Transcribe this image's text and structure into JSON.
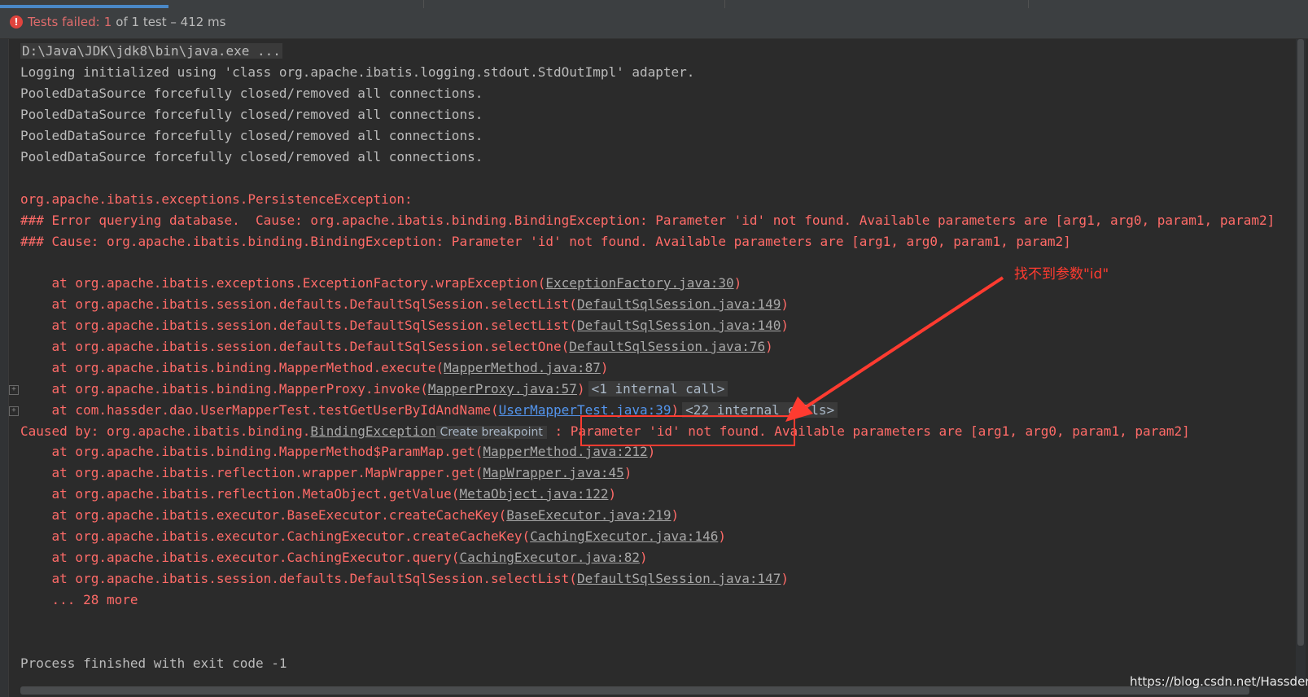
{
  "status": {
    "label": "Tests failed:",
    "count": "1",
    "detail": "of 1 test – 412 ms"
  },
  "console": {
    "command": "D:\\Java\\JDK\\jdk8\\bin\\java.exe ...",
    "log_lines": [
      "Logging initialized using 'class org.apache.ibatis.logging.stdout.StdOutImpl' adapter.",
      "PooledDataSource forcefully closed/removed all connections.",
      "PooledDataSource forcefully closed/removed all connections.",
      "PooledDataSource forcefully closed/removed all connections.",
      "PooledDataSource forcefully closed/removed all connections."
    ],
    "exception_lines": [
      "org.apache.ibatis.exceptions.PersistenceException: ",
      "### Error querying database.  Cause: org.apache.ibatis.binding.BindingException: Parameter 'id' not found. Available parameters are [arg1, arg0, param1, param2]",
      "### Cause: org.apache.ibatis.binding.BindingException: Parameter 'id' not found. Available parameters are [arg1, arg0, param1, param2]"
    ],
    "stack1": [
      {
        "pre": "    at org.apache.ibatis.exceptions.ExceptionFactory.wrapException(",
        "link": "ExceptionFactory.java:30",
        "post": ")"
      },
      {
        "pre": "    at org.apache.ibatis.session.defaults.DefaultSqlSession.selectList(",
        "link": "DefaultSqlSession.java:149",
        "post": ")"
      },
      {
        "pre": "    at org.apache.ibatis.session.defaults.DefaultSqlSession.selectList(",
        "link": "DefaultSqlSession.java:140",
        "post": ")"
      },
      {
        "pre": "    at org.apache.ibatis.session.defaults.DefaultSqlSession.selectOne(",
        "link": "DefaultSqlSession.java:76",
        "post": ")"
      },
      {
        "pre": "    at org.apache.ibatis.binding.MapperMethod.execute(",
        "link": "MapperMethod.java:87",
        "post": ")"
      },
      {
        "pre": "    at org.apache.ibatis.binding.MapperProxy.invoke(",
        "link": "MapperProxy.java:57",
        "post": ")",
        "hint": "<1 internal call>"
      },
      {
        "pre": "    at com.hassder.dao.UserMapperTest.testGetUserByIdAndName(",
        "link": "UserMapperTest.java:39",
        "post": ")",
        "hint": "<22 internal calls>"
      }
    ],
    "caused_by": {
      "pre": "Caused by: org.apache.ibatis.binding.",
      "link": "BindingException",
      "breakpoint": "Create breakpoint",
      "sep": " : ",
      "message": "Parameter 'id' not found.",
      "rest": " Available parameters are [arg1, arg0, param1, param2]"
    },
    "stack2": [
      {
        "pre": "    at org.apache.ibatis.binding.MapperMethod$ParamMap.get(",
        "link": "MapperMethod.java:212",
        "post": ")"
      },
      {
        "pre": "    at org.apache.ibatis.reflection.wrapper.MapWrapper.get(",
        "link": "MapWrapper.java:45",
        "post": ")"
      },
      {
        "pre": "    at org.apache.ibatis.reflection.MetaObject.getValue(",
        "link": "MetaObject.java:122",
        "post": ")"
      },
      {
        "pre": "    at org.apache.ibatis.executor.BaseExecutor.createCacheKey(",
        "link": "BaseExecutor.java:219",
        "post": ")"
      },
      {
        "pre": "    at org.apache.ibatis.executor.CachingExecutor.createCacheKey(",
        "link": "CachingExecutor.java:146",
        "post": ")"
      },
      {
        "pre": "    at org.apache.ibatis.executor.CachingExecutor.query(",
        "link": "CachingExecutor.java:82",
        "post": ")"
      },
      {
        "pre": "    at org.apache.ibatis.session.defaults.DefaultSqlSession.selectList(",
        "link": "DefaultSqlSession.java:147",
        "post": ")"
      }
    ],
    "more": "    ... 28 more",
    "exit": "Process finished with exit code -1"
  },
  "annotation": "找不到参数\"id\"",
  "watermark": "https://blog.csdn.net/Hassder",
  "colors": {
    "background": "#2b2b2b",
    "error_text": "#ff6b68",
    "normal_text": "#bbbbbb",
    "annotation_red": "#ff3b30",
    "link_blue": "#5394ec"
  },
  "icons": [
    "error-icon",
    "expand-fold-icon"
  ]
}
